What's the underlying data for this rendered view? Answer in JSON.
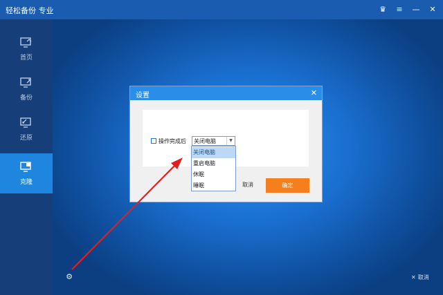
{
  "app": {
    "title": "轻松备份 专业"
  },
  "titlebar": {
    "icons": [
      "crown-icon",
      "menu-icon",
      "minimize-icon",
      "close-icon"
    ]
  },
  "sidebar": {
    "items": [
      {
        "label": "首页",
        "icon": "home-monitor-icon",
        "active": false
      },
      {
        "label": "备份",
        "icon": "backup-monitor-icon",
        "active": false
      },
      {
        "label": "还原",
        "icon": "restore-monitor-icon",
        "active": false
      },
      {
        "label": "克隆",
        "icon": "clone-monitor-icon",
        "active": true
      }
    ]
  },
  "footer": {
    "settings_icon": "gear-icon",
    "cancel_label": "取消"
  },
  "dialog": {
    "title": "设置",
    "option": {
      "checkbox_label": "操作完成后",
      "checked": false
    },
    "select": {
      "value": "关闭电脑"
    },
    "dropdown": {
      "items": [
        "关闭电脑",
        "重启电脑",
        "休眠",
        "睡眠"
      ],
      "selected_index": 0
    },
    "cancel_label": "取消",
    "ok_label": "确定"
  },
  "colors": {
    "accent_blue": "#2a8ee8",
    "active_nav": "#1f86e0",
    "ok_button": "#f57f1c",
    "annotation_arrow": "#e02020"
  }
}
